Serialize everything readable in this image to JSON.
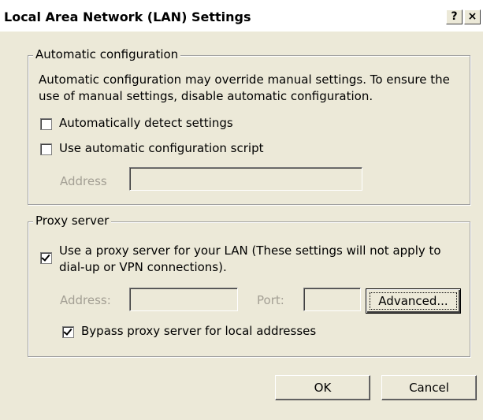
{
  "window": {
    "title": "Local Area Network (LAN) Settings",
    "help_glyph": "?",
    "close_glyph": "×"
  },
  "auto_config": {
    "legend": "Automatic configuration",
    "description": "Automatic configuration may override manual settings.  To ensure the use of manual settings, disable automatic configuration.",
    "detect_label": "Automatically detect settings",
    "detect_checked": false,
    "script_label": "Use automatic configuration script",
    "script_checked": false,
    "address_label": "Address",
    "address_value": ""
  },
  "proxy": {
    "legend": "Proxy server",
    "use_proxy_label": "Use a proxy server for your LAN (These settings will not apply to dial-up or VPN connections).",
    "use_proxy_checked": true,
    "address_label": "Address:",
    "address_value": "",
    "port_label": "Port:",
    "port_value": "",
    "advanced_label": "Advanced...",
    "bypass_label": "Bypass proxy server for local addresses",
    "bypass_checked": true
  },
  "footer": {
    "ok_label": "OK",
    "cancel_label": "Cancel"
  }
}
